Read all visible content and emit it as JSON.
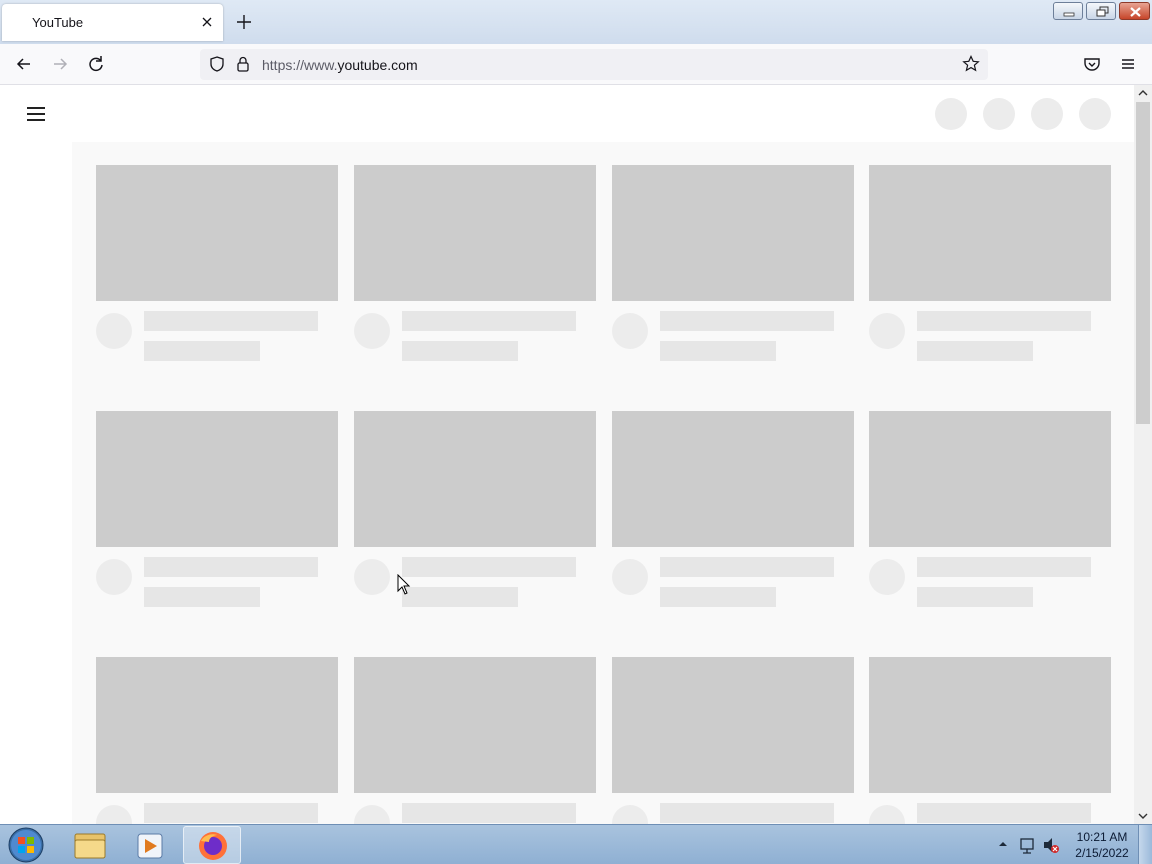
{
  "browser": {
    "tab": {
      "title": "YouTube"
    },
    "address": {
      "scheme": "https://www.",
      "host": "youtube.com"
    }
  },
  "taskbar": {
    "clock": {
      "time": "10:21 AM",
      "date": "2/15/2022"
    }
  },
  "colors": {
    "thumbnail_placeholder": "#cccccc",
    "text_placeholder": "#e6e6e6",
    "avatar_placeholder": "#ececec",
    "content_background": "#f9f9f9",
    "close_button": "#c7452a"
  },
  "icons": {
    "tab": [
      "close-icon",
      "plus-icon"
    ],
    "nav": [
      "back-arrow-icon",
      "forward-arrow-icon",
      "reload-icon",
      "shield-icon",
      "lock-icon",
      "star-icon",
      "pocket-icon",
      "hamburger-menu-icon"
    ],
    "taskbar": [
      "windows-start-icon",
      "folder-icon",
      "media-player-icon",
      "firefox-icon"
    ]
  },
  "loading_grid": {
    "rows": 3,
    "columns": 4
  }
}
